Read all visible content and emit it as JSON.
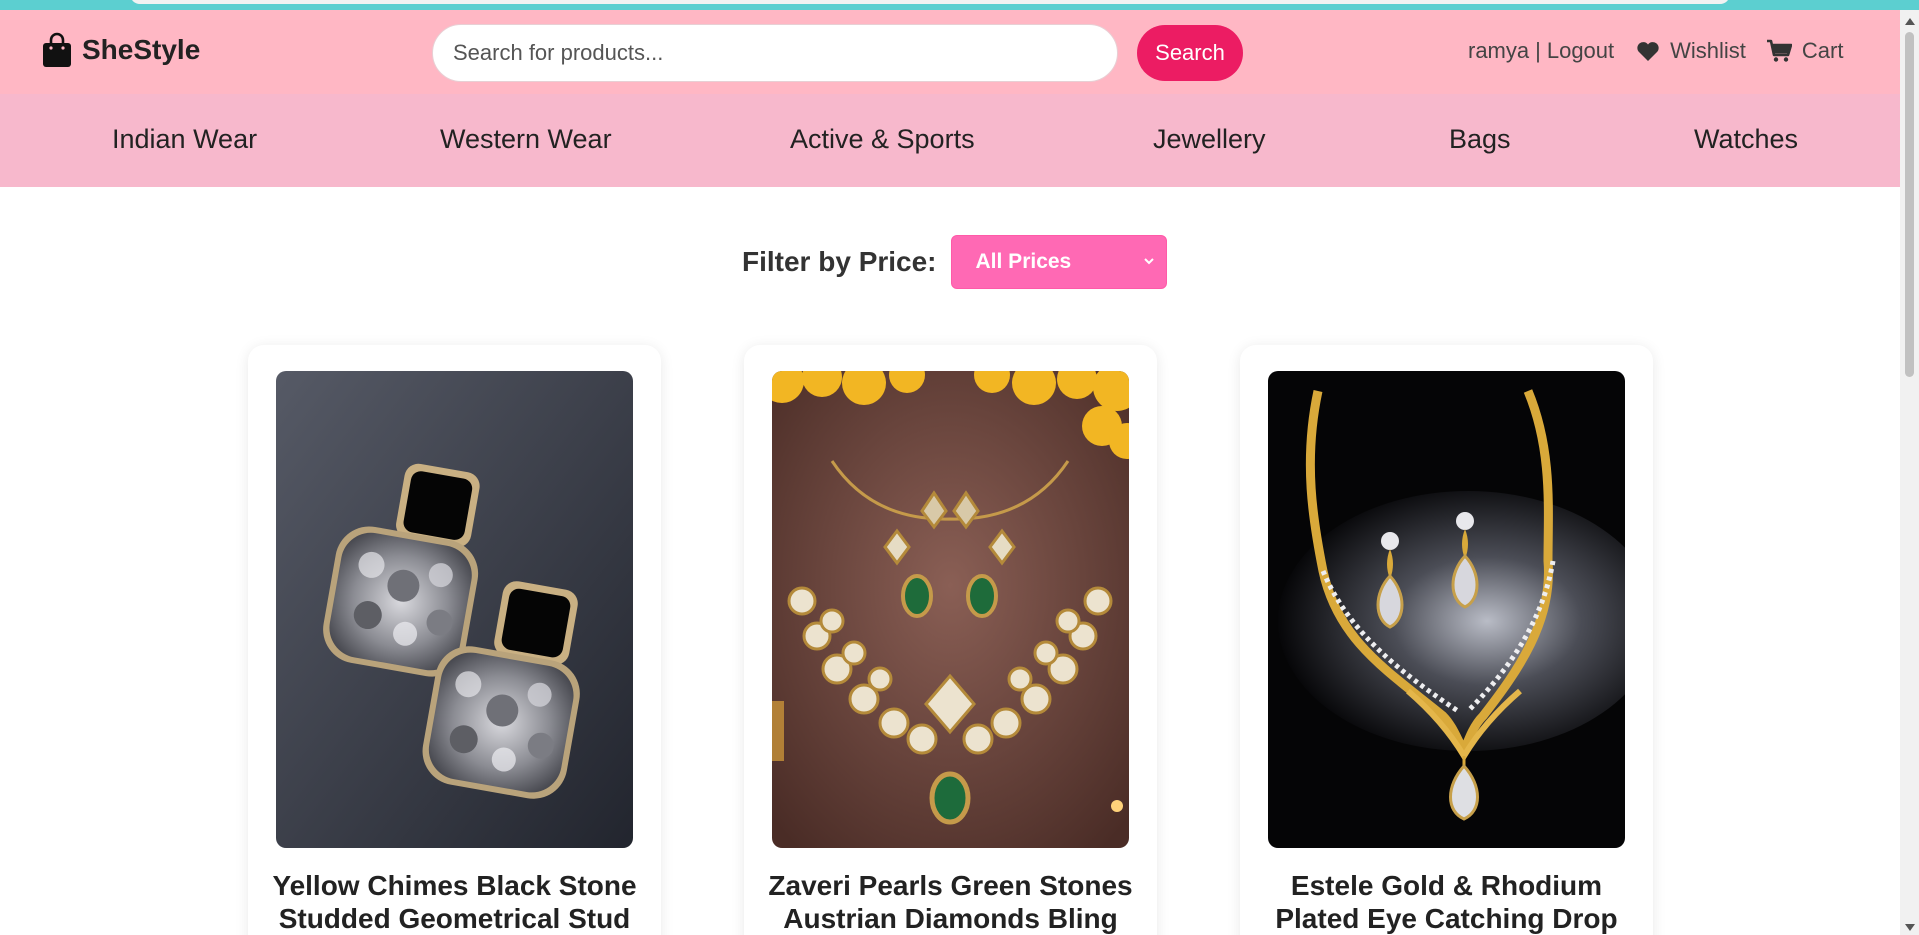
{
  "header": {
    "brand": "SheStyle",
    "search_placeholder": "Search for products...",
    "search_button": "Search",
    "user_name": "ramya",
    "separator": "|",
    "logout": "Logout",
    "wishlist": "Wishlist",
    "cart": "Cart"
  },
  "nav": {
    "items": [
      {
        "label": "Indian Wear"
      },
      {
        "label": "Western Wear"
      },
      {
        "label": "Active & Sports"
      },
      {
        "label": "Jewellery"
      },
      {
        "label": "Bags"
      },
      {
        "label": "Watches"
      }
    ]
  },
  "filter": {
    "label": "Filter by Price:",
    "selected": "All Prices"
  },
  "products": [
    {
      "title": "Yellow Chimes Black Stone Studded Geometrical Stud",
      "image": "black-stone-stud-earrings"
    },
    {
      "title": "Zaveri Pearls Green Stones Austrian Diamonds Bling",
      "image": "green-stone-necklace-set"
    },
    {
      "title": "Estele Gold & Rhodium Plated Eye Catching Drop",
      "image": "gold-drop-necklace-set"
    }
  ],
  "colors": {
    "header_bg": "#ffb7c4",
    "nav_bg": "#f7b8cc",
    "search_button": "#ec1c63",
    "filter_select": "#ff69b4",
    "top_strip": "#5ccfd0"
  },
  "icons": {
    "logo": "shopping-bag-icon",
    "wishlist": "heart-icon",
    "cart": "cart-icon"
  }
}
